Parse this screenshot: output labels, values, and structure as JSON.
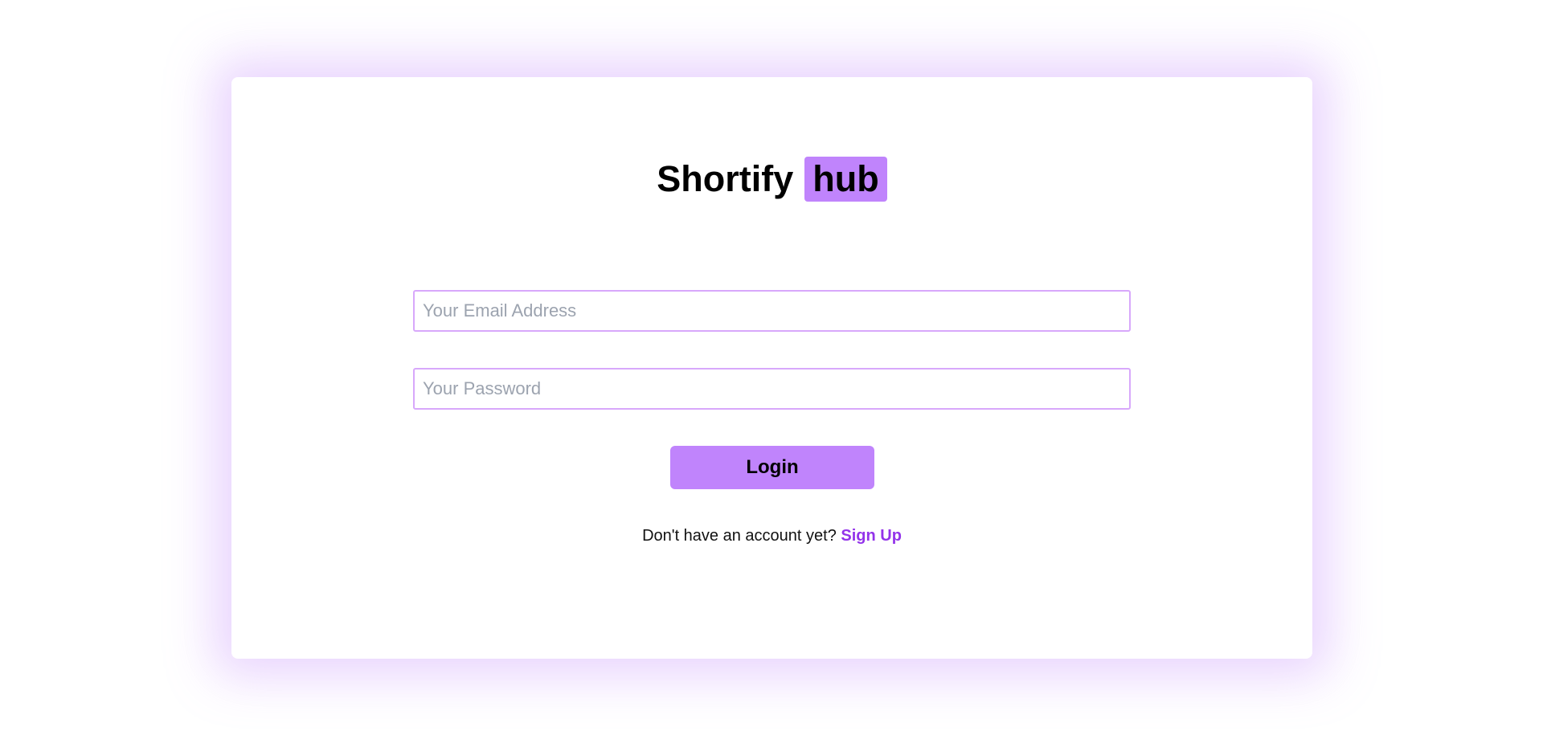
{
  "brand": {
    "name": "Shortify",
    "badge": "hub"
  },
  "form": {
    "email_placeholder": "Your Email Address",
    "email_value": "",
    "password_placeholder": "Your Password",
    "password_value": "",
    "login_label": "Login"
  },
  "signup": {
    "prompt": "Don't have an account yet?",
    "link_label": "Sign Up"
  },
  "colors": {
    "accent": "#c084fc",
    "link": "#9333ea",
    "input_border": "#d8a8fb",
    "placeholder": "#9ca3af"
  }
}
